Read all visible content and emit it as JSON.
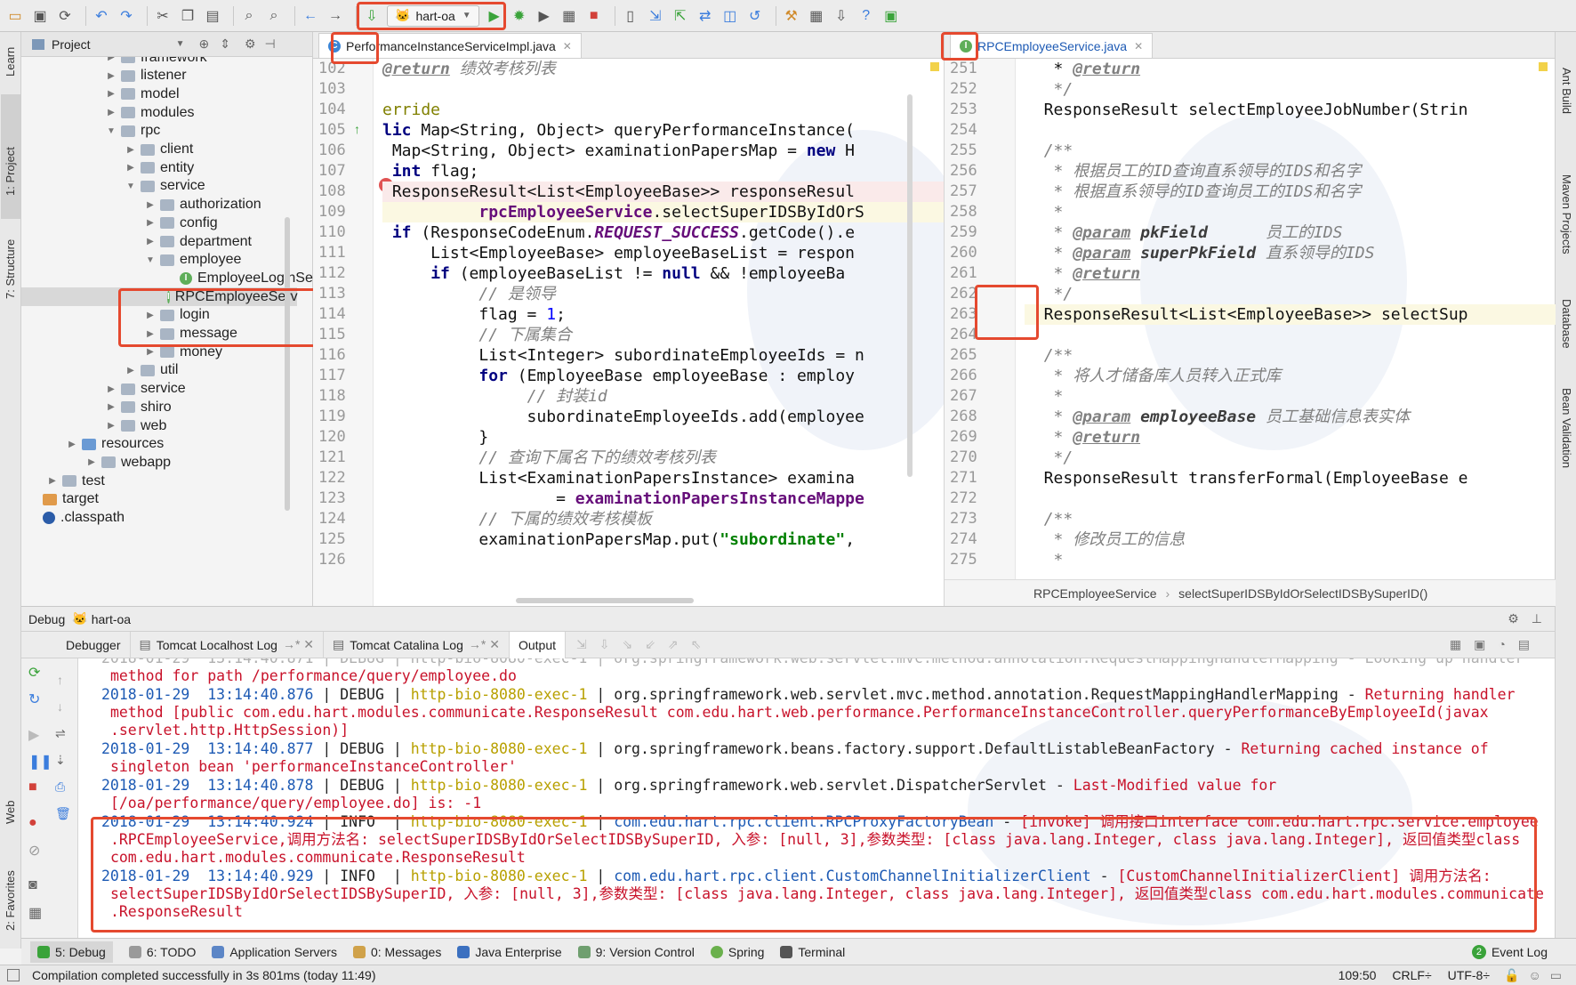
{
  "toolbar": {
    "run_config": "hart-oa"
  },
  "left_tools": {
    "learn": "Learn",
    "project": "1: Project",
    "structure": "7: Structure",
    "web": "Web",
    "favorites": "2: Favorites"
  },
  "right_tools": {
    "ant": "Ant Build",
    "maven": "Maven Projects",
    "database": "Database",
    "bean": "Bean Validation"
  },
  "project": {
    "title": "Project",
    "items": [
      {
        "label": "framework",
        "indent": 4,
        "kind": "folder",
        "arrow": "▶"
      },
      {
        "label": "listener",
        "indent": 4,
        "kind": "folder",
        "arrow": "▶"
      },
      {
        "label": "model",
        "indent": 4,
        "kind": "folder",
        "arrow": "▶"
      },
      {
        "label": "modules",
        "indent": 4,
        "kind": "folder",
        "arrow": "▶"
      },
      {
        "label": "rpc",
        "indent": 4,
        "kind": "folder",
        "arrow": "▼"
      },
      {
        "label": "client",
        "indent": 5,
        "kind": "folder",
        "arrow": "▶"
      },
      {
        "label": "entity",
        "indent": 5,
        "kind": "folder",
        "arrow": "▶"
      },
      {
        "label": "service",
        "indent": 5,
        "kind": "folder",
        "arrow": "▼"
      },
      {
        "label": "authorization",
        "indent": 6,
        "kind": "folder",
        "arrow": "▶"
      },
      {
        "label": "config",
        "indent": 6,
        "kind": "folder",
        "arrow": "▶"
      },
      {
        "label": "department",
        "indent": 6,
        "kind": "folder",
        "arrow": "▶"
      },
      {
        "label": "employee",
        "indent": 6,
        "kind": "folder",
        "arrow": "▼"
      },
      {
        "label": "EmployeeLoginSe",
        "indent": 7,
        "kind": "interface",
        "arrow": ""
      },
      {
        "label": "RPCEmployeeServ",
        "indent": 7,
        "kind": "interface",
        "arrow": ""
      },
      {
        "label": "login",
        "indent": 6,
        "kind": "folder",
        "arrow": "▶"
      },
      {
        "label": "message",
        "indent": 6,
        "kind": "folder",
        "arrow": "▶"
      },
      {
        "label": "money",
        "indent": 6,
        "kind": "folder",
        "arrow": "▶"
      },
      {
        "label": "util",
        "indent": 5,
        "kind": "folder",
        "arrow": "▶"
      },
      {
        "label": "service",
        "indent": 4,
        "kind": "folder",
        "arrow": "▶"
      },
      {
        "label": "shiro",
        "indent": 4,
        "kind": "folder",
        "arrow": "▶"
      },
      {
        "label": "web",
        "indent": 4,
        "kind": "folder",
        "arrow": "▶"
      },
      {
        "label": "resources",
        "indent": 2,
        "kind": "folderblue",
        "arrow": "▶"
      },
      {
        "label": "webapp",
        "indent": 3,
        "kind": "folder",
        "arrow": "▶"
      },
      {
        "label": "test",
        "indent": 1,
        "kind": "folder",
        "arrow": "▶"
      },
      {
        "label": "target",
        "indent": 0,
        "kind": "folderorange",
        "arrow": ""
      },
      {
        "label": ".classpath",
        "indent": 0,
        "kind": "file",
        "arrow": ""
      }
    ]
  },
  "editor_left": {
    "tab": "PerformanceInstanceServiceImpl.java",
    "line_numbers": [
      "102",
      "103",
      "104",
      "105",
      "106",
      "107",
      "108",
      "109",
      "110",
      "111",
      "112",
      "113",
      "114",
      "115",
      "116",
      "117",
      "118",
      "119",
      "120",
      "121",
      "122",
      "123",
      "124",
      "125",
      "126"
    ]
  },
  "editor_right": {
    "tab": "RPCEmployeeService.java",
    "line_numbers": [
      "251",
      "252",
      "253",
      "254",
      "255",
      "256",
      "257",
      "258",
      "259",
      "260",
      "261",
      "262",
      "263",
      "264",
      "265",
      "266",
      "267",
      "268",
      "269",
      "270",
      "271",
      "272",
      "273",
      "274",
      "275"
    ],
    "breadcrumb_class": "RPCEmployeeService",
    "breadcrumb_method": "selectSuperIDSByIdOrSelectIDSBySuperID()"
  },
  "debug": {
    "title": "Debug",
    "config": "hart-oa",
    "tabs": [
      "Debugger",
      "Tomcat Localhost Log",
      "Tomcat Catalina Log",
      "Output"
    ]
  },
  "bottom_tabs": [
    "5: Debug",
    "6: TODO",
    "Application Servers",
    "0: Messages",
    "Java Enterprise",
    "9: Version Control",
    "Spring",
    "Terminal"
  ],
  "event_log": "Event Log",
  "event_count": "2",
  "status": {
    "message": "Compilation completed successfully in 3s 801ms (today 11:49)",
    "position": "109:50",
    "line_sep": "CRLF÷",
    "encoding": "UTF-8÷"
  }
}
